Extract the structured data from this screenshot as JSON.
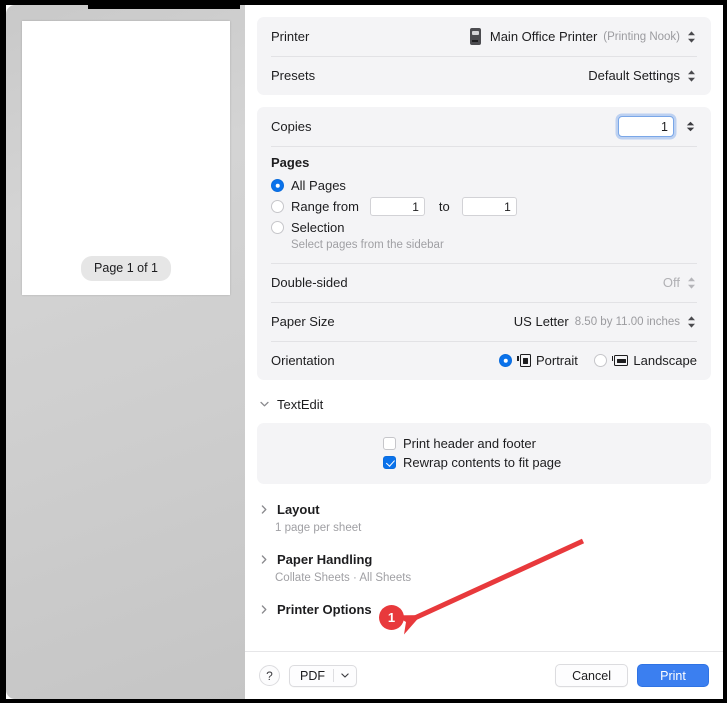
{
  "preview": {
    "page_indicator": "Page 1 of 1"
  },
  "settings": {
    "printer_row": {
      "label": "Printer",
      "icon": "printer-icon",
      "value": "Main Office Printer",
      "detail": "(Printing Nook)"
    },
    "presets_row": {
      "label": "Presets",
      "value": "Default Settings"
    },
    "copies_row": {
      "label": "Copies",
      "value": "1"
    },
    "pages_block": {
      "title": "Pages",
      "options": [
        {
          "label": "All Pages",
          "selected": true
        },
        {
          "label": "Range from",
          "selected": false
        },
        {
          "label": "Selection",
          "selected": false
        }
      ],
      "range_from": "1",
      "range_to_label": "to",
      "range_to": "1",
      "selection_hint": "Select pages from the sidebar"
    },
    "double_sided_row": {
      "label": "Double-sided",
      "value": "Off"
    },
    "paper_size_row": {
      "label": "Paper Size",
      "value": "US Letter",
      "detail": "8.50 by 11.00 inches"
    },
    "orientation_row": {
      "label": "Orientation",
      "options": [
        {
          "label": "Portrait",
          "selected": true
        },
        {
          "label": "Landscape",
          "selected": false
        }
      ]
    },
    "textedit_section": {
      "title": "TextEdit",
      "expanded": true,
      "checkboxes": [
        {
          "label": "Print header and footer",
          "checked": false
        },
        {
          "label": "Rewrap contents to fit page",
          "checked": true
        }
      ]
    },
    "collapsed_sections": [
      {
        "title": "Layout",
        "summary": "1 page per sheet"
      },
      {
        "title": "Paper Handling",
        "summary": "Collate Sheets · All Sheets"
      },
      {
        "title": "Printer Options",
        "summary": ""
      }
    ]
  },
  "footer": {
    "help_label": "?",
    "pdf_label": "PDF",
    "cancel_label": "Cancel",
    "print_label": "Print"
  },
  "annotation": {
    "badge_number": "1",
    "color": "#e8393c"
  }
}
